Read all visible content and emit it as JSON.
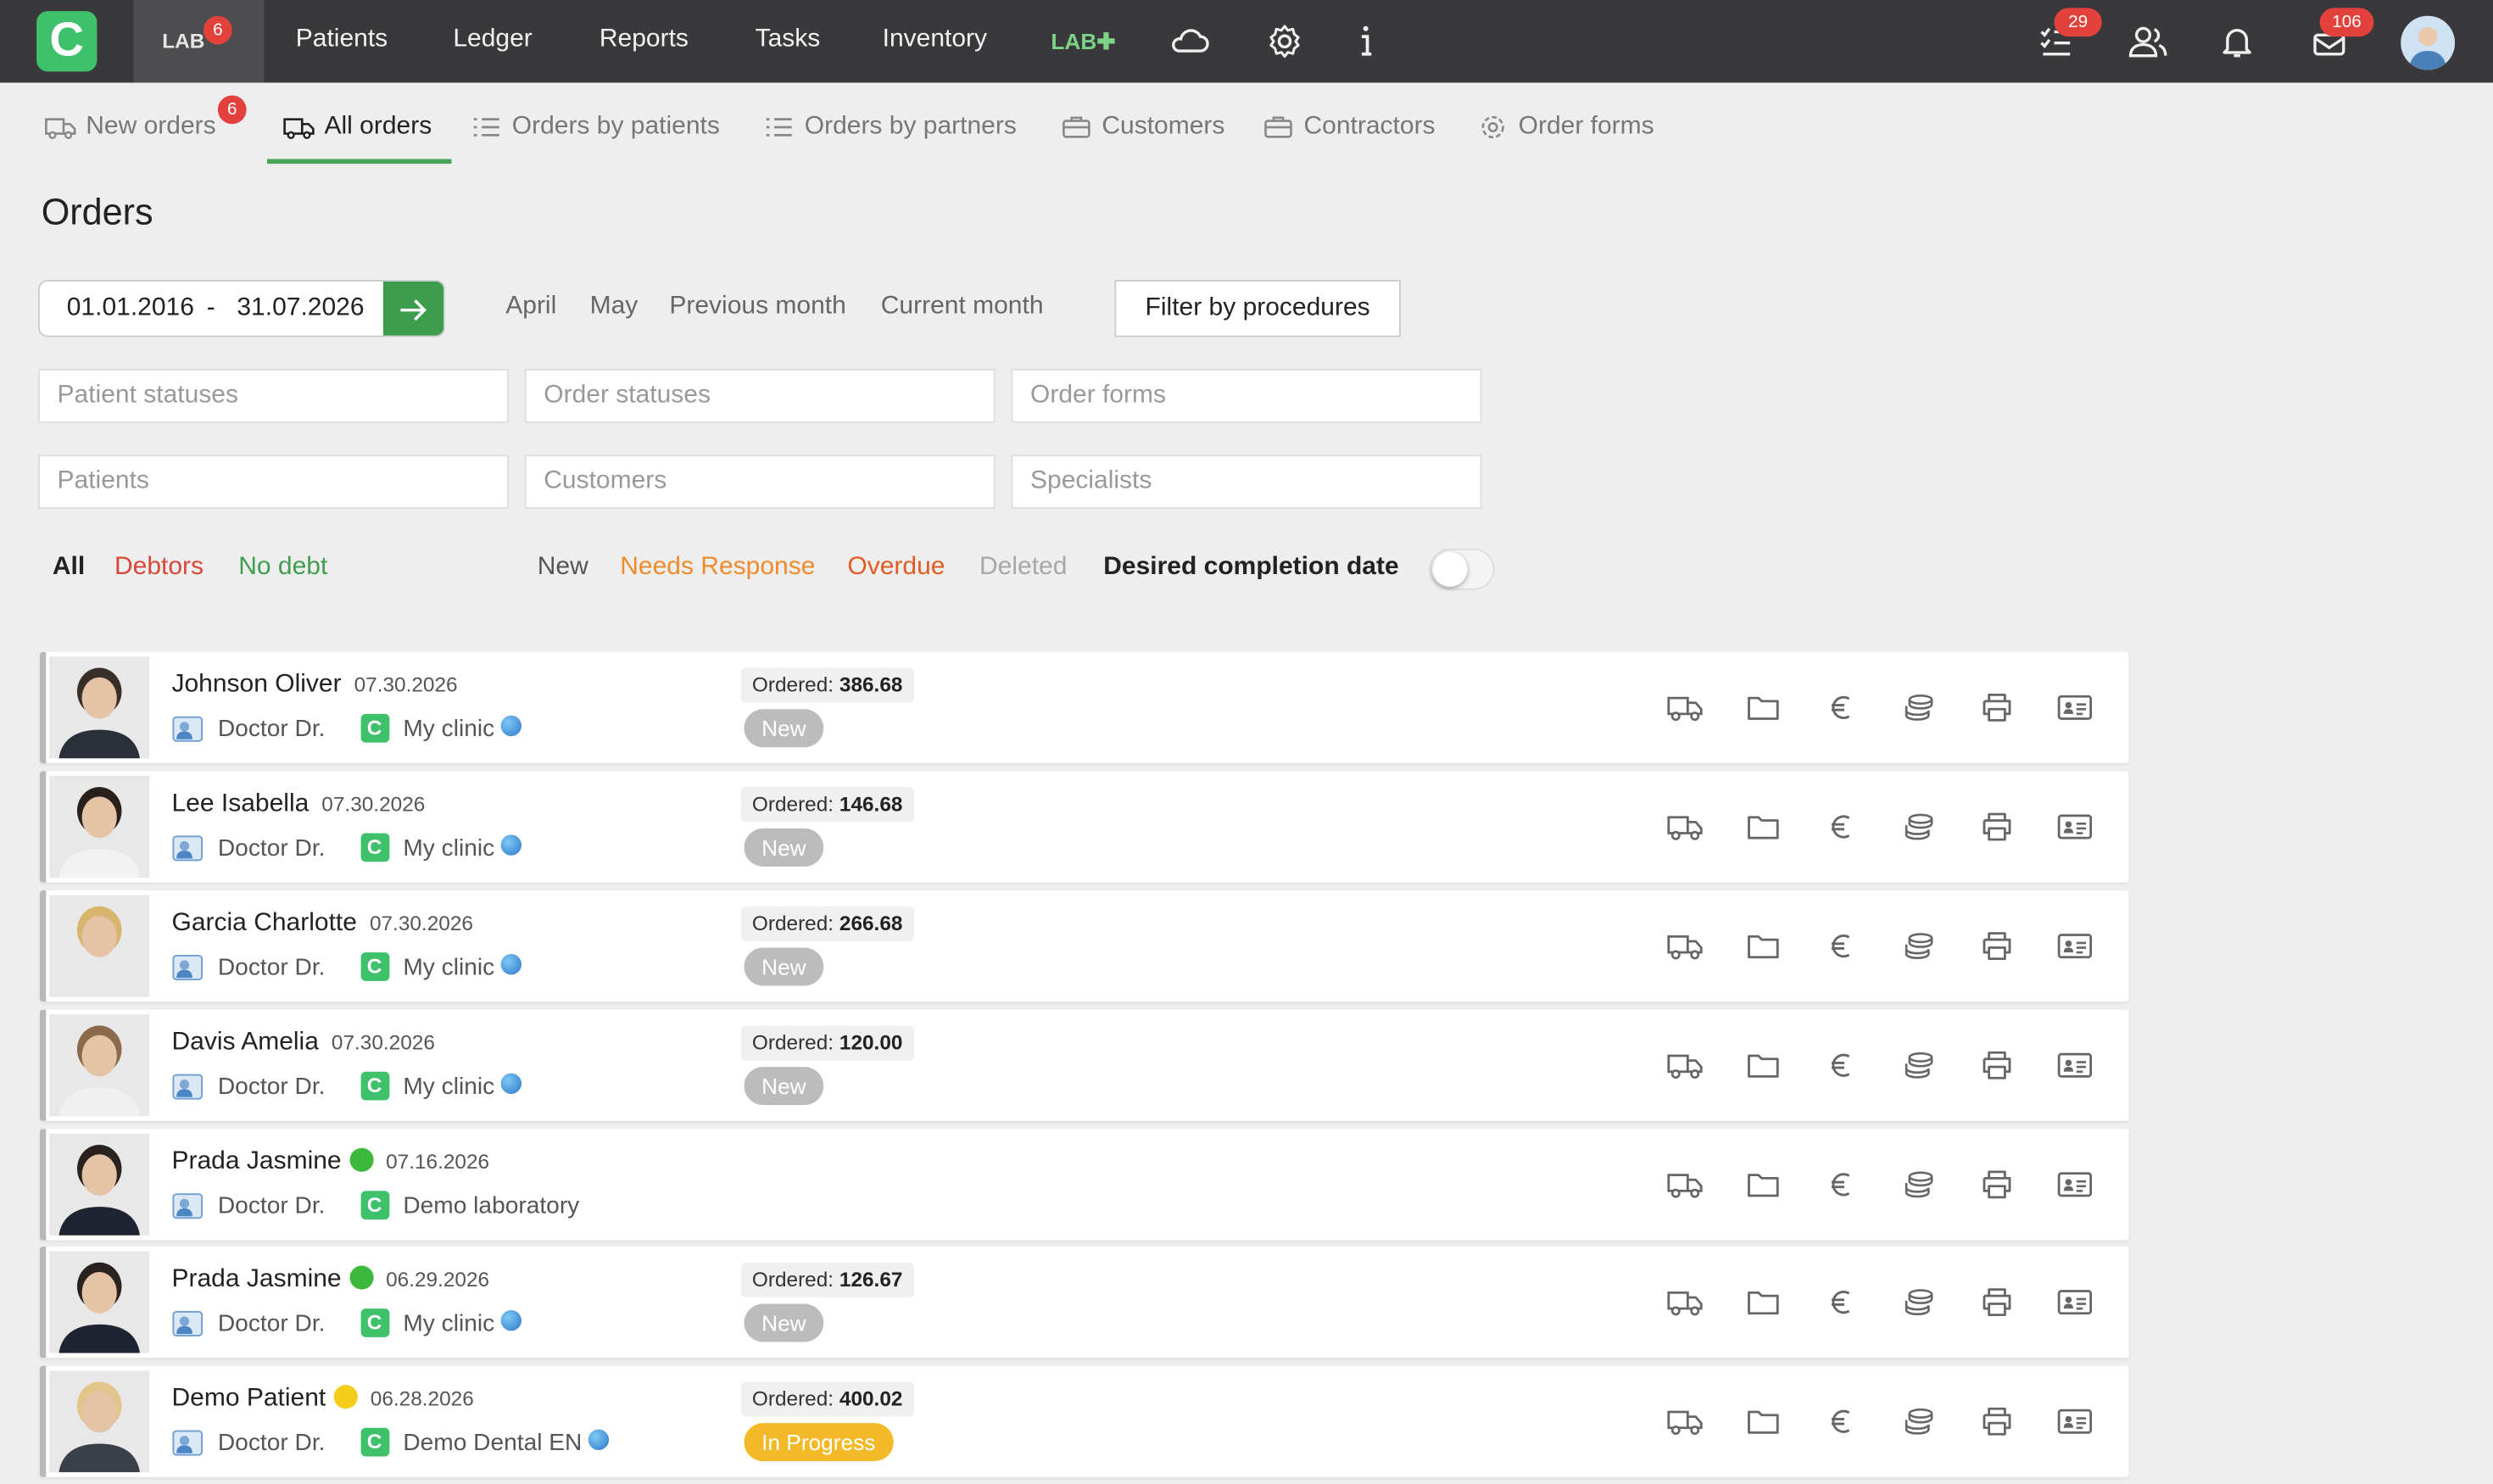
{
  "topbar": {
    "logo": "C",
    "lab_tab": {
      "label": "LAB",
      "badge": "6"
    },
    "nav": [
      "Patients",
      "Ledger",
      "Reports",
      "Tasks",
      "Inventory"
    ],
    "labplus": "LAB✚",
    "tasks_badge": "29",
    "messages_badge": "106",
    "icons": [
      "cloud-icon",
      "gear-icon",
      "info-icon",
      "task-list-icon",
      "users-icon",
      "bell-icon",
      "mail-icon"
    ]
  },
  "subnav": {
    "new_orders": {
      "label": "New orders",
      "badge": "6"
    },
    "all_orders": "All orders",
    "by_patients": "Orders by patients",
    "by_partners": "Orders by partners",
    "customers": "Customers",
    "contractors": "Contractors",
    "order_forms": "Order forms"
  },
  "page_title": "Orders",
  "date_range": {
    "from": "01.01.2016",
    "separator": "-",
    "to": "31.07.2026"
  },
  "quick_ranges": [
    "April",
    "May",
    "Previous month",
    "Current month"
  ],
  "filter_by_procedures": "Filter by procedures",
  "selects": {
    "patient_statuses": "Patient statuses",
    "order_statuses": "Order statuses",
    "order_forms": "Order forms",
    "patients": "Patients",
    "customers": "Customers",
    "specialists": "Specialists"
  },
  "debt_filters": [
    "All",
    "Debtors",
    "No debt"
  ],
  "status_filters": [
    "New",
    "Needs Response",
    "Overdue",
    "Deleted"
  ],
  "desired_completion": {
    "label": "Desired completion date",
    "enabled": false
  },
  "colors": {
    "accent": "#3c9d4c",
    "debtors": "#d9473a",
    "nodebt": "#3f9e4f",
    "needs_response": "#ef8b2c",
    "overdue": "#e35a24",
    "deleted": "#a7a7a7",
    "status_new": "#bcbcbc",
    "status_in_progress": "#f4b927"
  },
  "orders": [
    {
      "name": "Johnson Oliver",
      "date": "07.30.2026",
      "doctor": "Doctor Dr.",
      "clinic": "My clinic",
      "globe": true,
      "ordered_label": "Ordered:",
      "amount": "386.68",
      "status": "New",
      "dot": null
    },
    {
      "name": "Lee Isabella",
      "date": "07.30.2026",
      "doctor": "Doctor Dr.",
      "clinic": "My clinic",
      "globe": true,
      "ordered_label": "Ordered:",
      "amount": "146.68",
      "status": "New",
      "dot": null
    },
    {
      "name": "Garcia Charlotte",
      "date": "07.30.2026",
      "doctor": "Doctor Dr.",
      "clinic": "My clinic",
      "globe": true,
      "ordered_label": "Ordered:",
      "amount": "266.68",
      "status": "New",
      "dot": null
    },
    {
      "name": "Davis Amelia",
      "date": "07.30.2026",
      "doctor": "Doctor Dr.",
      "clinic": "My clinic",
      "globe": true,
      "ordered_label": "Ordered:",
      "amount": "120.00",
      "status": "New",
      "dot": null
    },
    {
      "name": "Prada Jasmine",
      "date": "07.16.2026",
      "doctor": "Doctor Dr.",
      "clinic": "Demo laboratory",
      "globe": false,
      "ordered_label": "",
      "amount": "",
      "status": "",
      "dot": "#3cb93c"
    },
    {
      "name": "Prada Jasmine",
      "date": "06.29.2026",
      "doctor": "Doctor Dr.",
      "clinic": "My clinic",
      "globe": true,
      "ordered_label": "Ordered:",
      "amount": "126.67",
      "status": "New",
      "dot": "#3cb93c"
    },
    {
      "name": "Demo Patient",
      "date": "06.28.2026",
      "doctor": "Doctor Dr.",
      "clinic": "Demo Dental EN",
      "globe": true,
      "ordered_label": "Ordered:",
      "amount": "400.02",
      "status": "In Progress",
      "dot": "#f4cc1c"
    }
  ],
  "row_actions": [
    "truck-icon",
    "folder-icon",
    "euro-icon",
    "coins-icon",
    "printer-icon",
    "id-card-icon"
  ]
}
